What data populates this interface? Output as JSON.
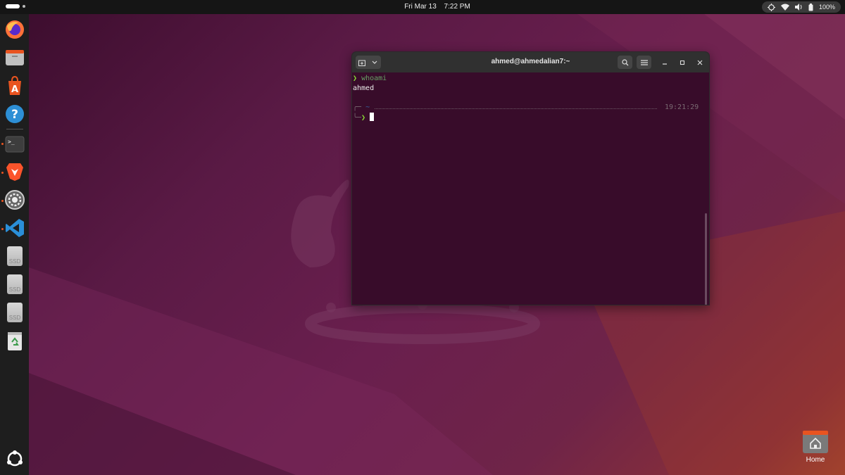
{
  "topbar": {
    "date": "Fri Mar 13",
    "time": "7:22 PM",
    "battery": "100%"
  },
  "dock": {
    "items": [
      "firefox-icon",
      "files-icon",
      "app-center-icon",
      "help-icon",
      "terminal-icon",
      "brave-icon",
      "settings-icon",
      "vscode-icon",
      "ssd-drive-icon",
      "ssd-drive-icon",
      "ssd-drive-icon",
      "trash-icon",
      "show-apps-icon"
    ],
    "ssd_label": "SSD"
  },
  "terminal": {
    "title": "ahmed@ahmedalian7:~",
    "prompt1_arrow": "❯",
    "prompt1_cmd": "whoami",
    "output": "ahmed",
    "prompt2_corner_top": "╭─",
    "prompt2_dir": "~",
    "prompt2_time": "19:21:29",
    "prompt2_corner_bottom": "╰─",
    "prompt2_arrow": "❯"
  },
  "desktop": {
    "home_label": "Home"
  },
  "colors": {
    "accent": "#e95420",
    "terminal_bg": "#380c2a",
    "prompt_green": "#8ae234"
  }
}
